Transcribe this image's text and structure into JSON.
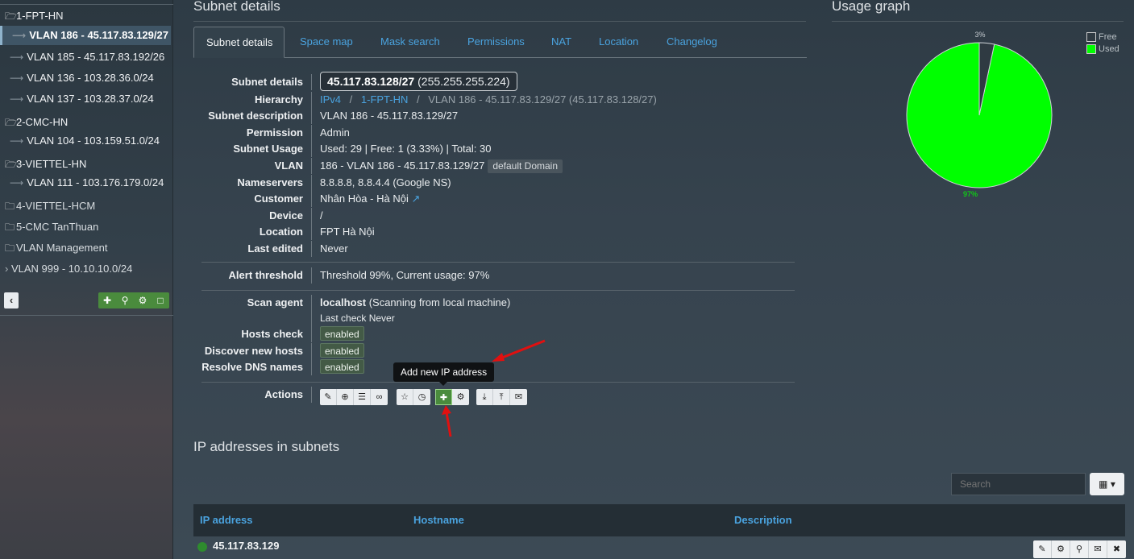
{
  "sidebar": {
    "items": [
      {
        "label": "1-FPT-HN",
        "type": "folder"
      },
      {
        "label": "VLAN 186 - 45.117.83.129/27",
        "type": "child",
        "active": true
      },
      {
        "label": "VLAN 185 - 45.117.83.192/26",
        "type": "child"
      },
      {
        "label": "VLAN 136 - 103.28.36.0/24",
        "type": "child"
      },
      {
        "label": "VLAN 137 - 103.28.37.0/24",
        "type": "child"
      },
      {
        "label": "2-CMC-HN",
        "type": "folder"
      },
      {
        "label": "VLAN 104 - 103.159.51.0/24",
        "type": "child"
      },
      {
        "label": "3-VIETTEL-HN",
        "type": "folder"
      },
      {
        "label": "VLAN 111 - 103.176.179.0/24",
        "type": "child"
      },
      {
        "label": "4-VIETTEL-HCM",
        "type": "folder-closed"
      },
      {
        "label": "5-CMC TanThuan",
        "type": "folder-closed"
      },
      {
        "label": "VLAN Management",
        "type": "folder-closed"
      },
      {
        "label": "VLAN 999 - 10.10.10.0/24",
        "type": "leaf"
      }
    ],
    "toolbar": {
      "collapse_icon": "chevron-left-icon",
      "icons": [
        "plus-icon",
        "search-icon",
        "gears-icon",
        "folder-icon"
      ]
    }
  },
  "header": {
    "subnet_details_title": "Subnet details",
    "usage_graph_title": "Usage graph"
  },
  "tabs": [
    {
      "label": "Subnet details",
      "active": true
    },
    {
      "label": "Space map"
    },
    {
      "label": "Mask search"
    },
    {
      "label": "Permissions"
    },
    {
      "label": "NAT"
    },
    {
      "label": "Location"
    },
    {
      "label": "Changelog"
    }
  ],
  "details": {
    "subnet_details": {
      "label": "Subnet details",
      "subnet": "45.117.83.128/27",
      "mask": "(255.255.255.224)"
    },
    "hierarchy": {
      "label": "Hierarchy",
      "root": "IPv4",
      "section": "1-FPT-HN",
      "current": "VLAN 186 - 45.117.83.129/27 (45.117.83.128/27)",
      "sep": "/"
    },
    "subnet_description": {
      "label": "Subnet description",
      "value": "VLAN 186 - 45.117.83.129/27"
    },
    "permission": {
      "label": "Permission",
      "value": "Admin"
    },
    "subnet_usage": {
      "label": "Subnet Usage",
      "value": "Used: 29 | Free: 1 (3.33%) | Total: 30"
    },
    "vlan": {
      "label": "VLAN",
      "value": "186 - VLAN 186 - 45.117.83.129/27",
      "badge": "default Domain"
    },
    "nameservers": {
      "label": "Nameservers",
      "value": "8.8.8.8, 8.8.4.4 (Google NS)"
    },
    "customer": {
      "label": "Customer",
      "value": "Nhân Hòa - Hà Nội"
    },
    "device": {
      "label": "Device",
      "value": "/"
    },
    "location": {
      "label": "Location",
      "value": "FPT Hà Nội"
    },
    "last_edited": {
      "label": "Last edited",
      "value": "Never"
    },
    "alert_threshold": {
      "label": "Alert threshold",
      "value": "Threshold 99%, Current usage: 97%"
    },
    "scan_agent": {
      "label": "Scan agent",
      "name": "localhost",
      "desc": "(Scanning from local machine)",
      "last_check": "Last check Never"
    },
    "hosts_check": {
      "label": "Hosts check",
      "value": "enabled"
    },
    "discover_new_hosts": {
      "label": "Discover new hosts",
      "value": "enabled"
    },
    "resolve_dns": {
      "label": "Resolve DNS names",
      "value": "enabled"
    },
    "actions": {
      "label": "Actions"
    }
  },
  "tooltip": {
    "text": "Add new IP address"
  },
  "usage_graph": {
    "legend": [
      {
        "label": "Free",
        "color": "#2f3a42"
      },
      {
        "label": "Used",
        "color": "#00ff00"
      }
    ],
    "free_label": "3%",
    "used_label": "97%",
    "free_fraction": 0.0333,
    "used_fraction": 0.9667,
    "used_color": "#00ff00",
    "free_color": "#2f3a42"
  },
  "ip_section": {
    "title": "IP addresses in subnets",
    "search_placeholder": "Search",
    "columns": [
      "IP address",
      "Hostname",
      "Description"
    ],
    "rows": [
      {
        "ip": "45.117.83.129",
        "status_color": "#2e8b2e"
      }
    ]
  },
  "colors": {
    "accent": "#4aa3df",
    "action_green": "#4a8b3d",
    "annotation_red": "#e01010"
  }
}
